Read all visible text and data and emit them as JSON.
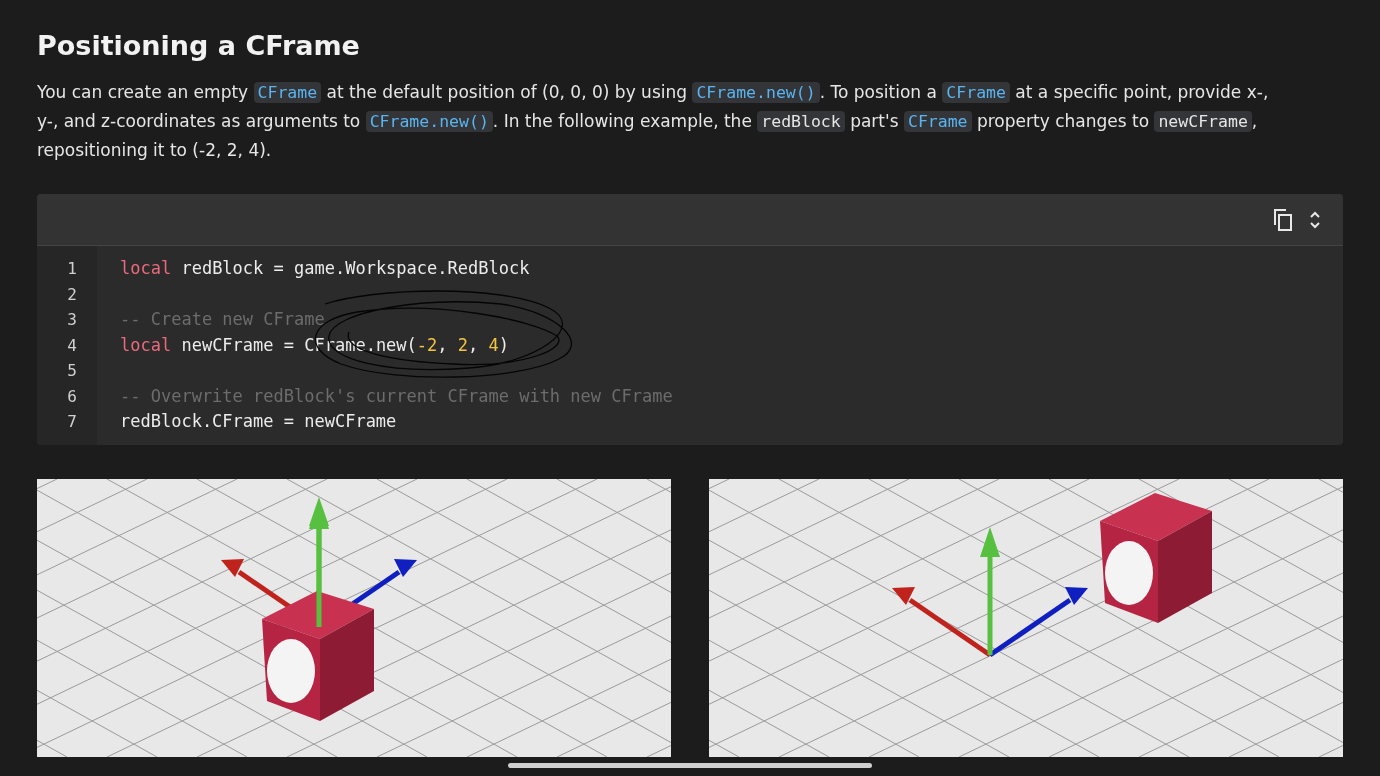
{
  "heading": "Positioning a CFrame",
  "paragraph": [
    {
      "kind": "text",
      "text": "You can create an empty "
    },
    {
      "kind": "api",
      "text": "CFrame"
    },
    {
      "kind": "text",
      "text": " at the default position of (0, 0, 0) by using "
    },
    {
      "kind": "api",
      "text": "CFrame.new()"
    },
    {
      "kind": "text",
      "text": ". To position a "
    },
    {
      "kind": "api",
      "text": "CFrame"
    },
    {
      "kind": "text",
      "text": " at a specific point, provide x-, y-, and z-coordinates as arguments to "
    },
    {
      "kind": "api",
      "text": "CFrame.new()"
    },
    {
      "kind": "text",
      "text": ". In the following example, the "
    },
    {
      "kind": "code",
      "text": "redBlock"
    },
    {
      "kind": "text",
      "text": " part's "
    },
    {
      "kind": "api",
      "text": "CFrame"
    },
    {
      "kind": "text",
      "text": " property changes to "
    },
    {
      "kind": "code",
      "text": "newCFrame"
    },
    {
      "kind": "text",
      "text": ", repositioning it to (-2, 2, 4)."
    }
  ],
  "code": {
    "lines": [
      {
        "number": "1",
        "tokens": [
          {
            "kind": "keyword",
            "text": "local"
          },
          {
            "kind": "plain",
            "text": " redBlock = game.Workspace.RedBlock"
          }
        ]
      },
      {
        "number": "2"
      },
      {
        "number": "3",
        "tokens": [
          {
            "kind": "comment",
            "text": "-- Create new CFrame"
          }
        ]
      },
      {
        "number": "4",
        "tokens": [
          {
            "kind": "keyword",
            "text": "local"
          },
          {
            "kind": "plain",
            "text": " newCFrame = CFrame.new("
          },
          {
            "kind": "number",
            "text": "-2"
          },
          {
            "kind": "plain",
            "text": ", "
          },
          {
            "kind": "number",
            "text": "2"
          },
          {
            "kind": "plain",
            "text": ", "
          },
          {
            "kind": "number",
            "text": "4"
          },
          {
            "kind": "plain",
            "text": ")"
          }
        ]
      },
      {
        "number": "5"
      },
      {
        "number": "6",
        "tokens": [
          {
            "kind": "comment",
            "text": "-- Overwrite redBlock's current CFrame with new CFrame"
          }
        ]
      },
      {
        "number": "7",
        "tokens": [
          {
            "kind": "plain",
            "text": "redBlock.CFrame = newCFrame"
          }
        ]
      }
    ]
  },
  "scenes": [
    {
      "kind": "origin"
    },
    {
      "kind": "moved"
    }
  ]
}
